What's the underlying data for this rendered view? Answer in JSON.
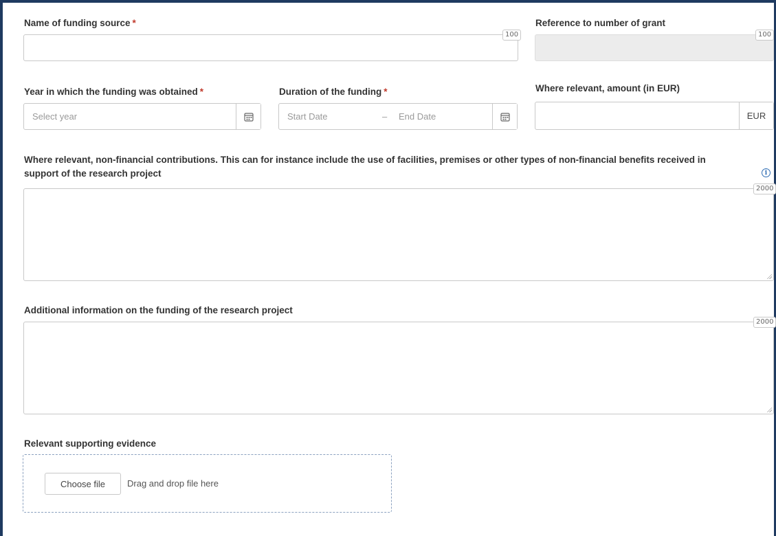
{
  "funding_source": {
    "label": "Name of funding source",
    "required_mark": "*",
    "value": "",
    "counter": "100"
  },
  "grant_reference": {
    "label": "Reference to number of grant",
    "value": "",
    "counter": "100"
  },
  "year_obtained": {
    "label": "Year in which the funding was obtained",
    "required_mark": "*",
    "placeholder": "Select year",
    "icon": "calendar-icon"
  },
  "duration": {
    "label": "Duration of the funding",
    "required_mark": "*",
    "start_placeholder": "Start Date",
    "separator": "–",
    "end_placeholder": "End Date",
    "icon": "calendar-icon"
  },
  "amount": {
    "label": "Where relevant, amount (in EUR)",
    "value": "",
    "currency": "EUR"
  },
  "non_financial": {
    "label": "Where relevant, non-financial contributions. This can for instance include the use of facilities, premises or other types of non-financial benefits received in support of the research project",
    "value": "",
    "counter": "2000",
    "icon": "info-icon",
    "icon_glyph": "i"
  },
  "additional_info": {
    "label": "Additional information on the funding of the research project",
    "value": "",
    "counter": "2000"
  },
  "evidence": {
    "label": "Relevant supporting evidence",
    "choose_label": "Choose file",
    "drag_text": "Drag and drop file here"
  },
  "colors": {
    "frame": "#1f3a60",
    "required": "#c0392b",
    "info": "#2e6db4",
    "dropzone_border": "#8aa0bf",
    "disabled_bg": "#ececec"
  }
}
